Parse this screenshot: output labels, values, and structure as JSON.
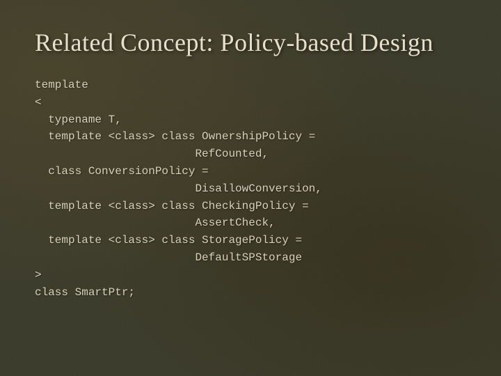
{
  "slide": {
    "title": "Related Concept: Policy-based Design",
    "code": {
      "line1": "template",
      "line2": "<",
      "line3": "  typename T,",
      "line4": "  template <class> class OwnershipPolicy =",
      "line5": "                        RefCounted,",
      "line6": "  class ConversionPolicy =",
      "line7": "                        DisallowConversion,",
      "line8": "  template <class> class CheckingPolicy =",
      "line9": "                        AssertCheck,",
      "line10": "  template <class> class StoragePolicy =",
      "line11": "                        DefaultSPStorage",
      "line12": ">",
      "line13": "class SmartPtr;"
    }
  }
}
